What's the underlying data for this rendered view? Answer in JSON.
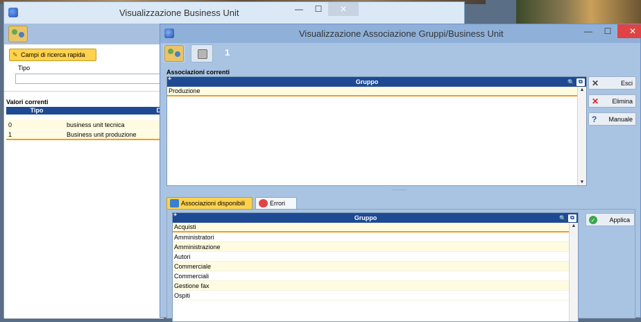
{
  "back_window": {
    "title": "Visualizzazione Business Unit",
    "quick_search_label": "Campi di ricerca rapida",
    "field_tipo_label": "Tipo",
    "field_tipo_value": "",
    "section_title": "Valori correnti",
    "columns": [
      "Tipo",
      "D"
    ],
    "rows": [
      {
        "tipo": "0",
        "descr": "business unit tecnica"
      },
      {
        "tipo": "1",
        "descr": "Business unit produzione"
      }
    ]
  },
  "front_window": {
    "title": "Visualizzazione Associazione Gruppi/Business Unit",
    "toolbar_count": "1",
    "current_section_title": "Associazioni correnti",
    "grid_column": "Gruppo",
    "current_rows": [
      "Produzione"
    ],
    "buttons": {
      "esci": "Esci",
      "elimina": "Elimina",
      "manuale": "Manuale",
      "applica": "Applica"
    },
    "tabs": {
      "available": "Associazioni disponibili",
      "errors": "Errori"
    },
    "available_column": "Gruppo",
    "available_rows": [
      "Acquisti",
      "Amministratori",
      "Amministrazione",
      "Autori",
      "Commerciale",
      "Commerciali",
      "Gestione fax",
      "Ospiti"
    ]
  },
  "window_controls": {
    "minimize": "—",
    "maximize": "☐",
    "close": "✕"
  }
}
